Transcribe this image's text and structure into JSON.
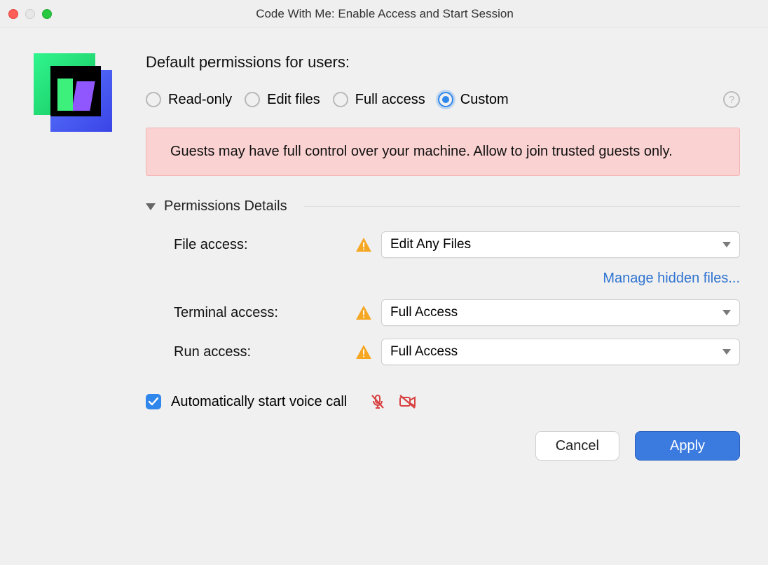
{
  "window": {
    "title": "Code With Me: Enable Access and Start Session"
  },
  "heading": "Default permissions for users:",
  "radios": {
    "readonly": "Read-only",
    "edit": "Edit files",
    "full": "Full access",
    "custom": "Custom",
    "selected": "custom"
  },
  "banner": "Guests may have full control over your machine. Allow to join trusted guests only.",
  "section": {
    "title": "Permissions Details"
  },
  "details": {
    "fileLabel": "File access:",
    "fileValue": "Edit Any Files",
    "manageLink": "Manage hidden files...",
    "terminalLabel": "Terminal access:",
    "terminalValue": "Full Access",
    "runLabel": "Run access:",
    "runValue": "Full Access"
  },
  "voice": {
    "checked": true,
    "label": "Automatically start voice call"
  },
  "buttons": {
    "cancel": "Cancel",
    "apply": "Apply"
  }
}
